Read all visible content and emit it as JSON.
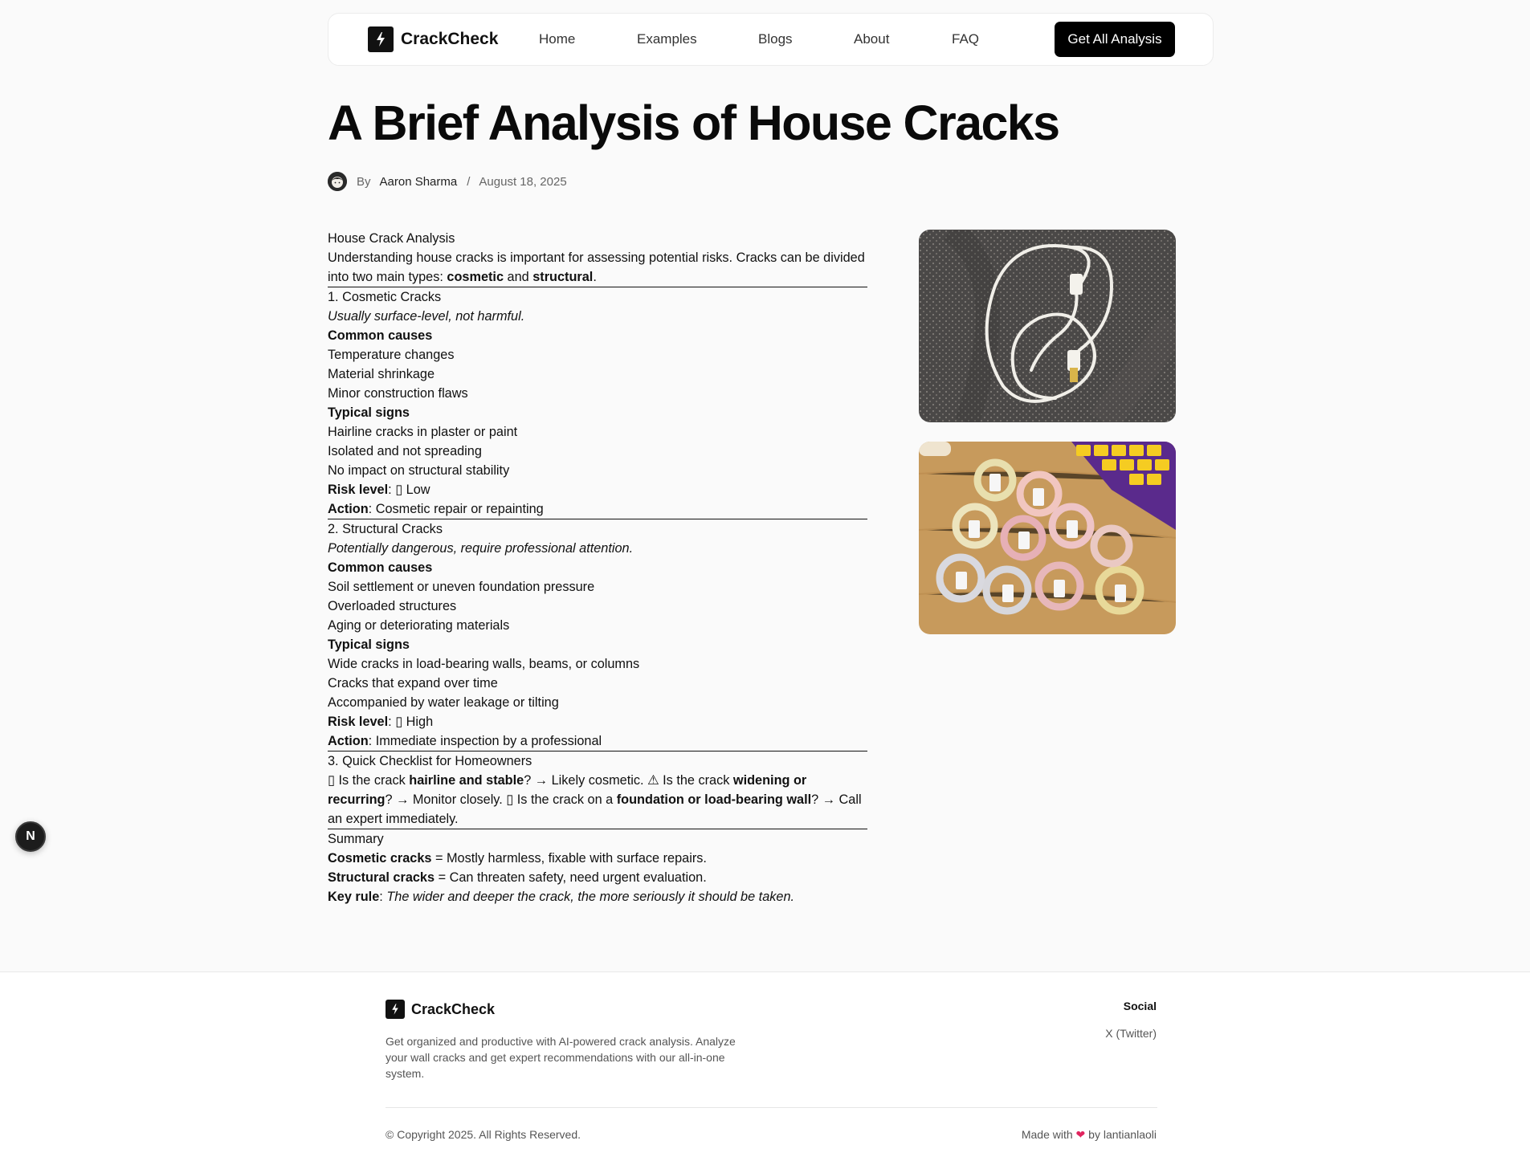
{
  "header": {
    "brand": "CrackCheck",
    "nav": [
      "Home",
      "Examples",
      "Blogs",
      "About",
      "FAQ"
    ],
    "cta": "Get All Analysis"
  },
  "post": {
    "title": "A Brief Analysis of House Cracks",
    "by": "By",
    "author": "Aaron Sharma",
    "separator": "/",
    "date": "August 18, 2025"
  },
  "article": {
    "heading": "House Crack Analysis",
    "intro_1": "Understanding house cracks is important for assessing potential risks. Cracks can be divided into two main types: ",
    "intro_b1": "cosmetic",
    "intro_2": " and ",
    "intro_b2": "structural",
    "intro_3": ".",
    "s1": {
      "title": "1. Cosmetic Cracks",
      "subtitle": "Usually surface-level, not harmful.",
      "causes_label": "Common causes",
      "causes": [
        "Temperature changes",
        "Material shrinkage",
        "Minor construction flaws"
      ],
      "signs_label": "Typical signs",
      "signs": [
        "Hairline cracks in plaster or paint",
        "Isolated and not spreading",
        "No impact on structural stability"
      ],
      "risk_label": "Risk level",
      "risk_value": ": ▯ Low",
      "action_label": "Action",
      "action_value": ": Cosmetic repair or repainting"
    },
    "s2": {
      "title": "2. Structural Cracks",
      "subtitle": "Potentially dangerous, require professional attention.",
      "causes_label": "Common causes",
      "causes": [
        "Soil settlement or uneven foundation pressure",
        "Overloaded structures",
        "Aging or deteriorating materials"
      ],
      "signs_label": "Typical signs",
      "signs": [
        "Wide cracks in load-bearing walls, beams, or columns",
        "Cracks that expand over time",
        "Accompanied by water leakage or tilting"
      ],
      "risk_label": "Risk level",
      "risk_value": ": ▯ High",
      "action_label": "Action",
      "action_value": ": Immediate inspection by a professional"
    },
    "s3": {
      "title": "3. Quick Checklist for Homeowners",
      "c1": "▯ Is the crack ",
      "c1b": "hairline and stable",
      "c2": "? → Likely cosmetic. ⚠ Is the crack ",
      "c2b": "widening or recurring",
      "c3": "? → Monitor closely. ▯ Is the crack on a ",
      "c3b": "foundation or load-bearing wall",
      "c4": "? → Call an expert immediately."
    },
    "summary": {
      "title": "Summary",
      "l1b": "Cosmetic cracks",
      "l1": " = Mostly harmless, fixable with surface repairs.",
      "l2b": "Structural cracks",
      "l2": " = Can threaten safety, need urgent evaluation.",
      "l3b": "Key rule",
      "l3": ": ",
      "l3i": "The wider and deeper the crack, the more seriously it should be taken."
    }
  },
  "badge": "N",
  "footer": {
    "brand": "CrackCheck",
    "description": "Get organized and productive with AI-powered crack analysis. Analyze your wall cracks and get expert recommendations with our all-in-one system.",
    "social_title": "Social",
    "social_link": "X (Twitter)",
    "copyright": "© Copyright 2025. All Rights Reserved.",
    "made_1": "Made with ",
    "heart": "❤",
    "made_2": " by lantianlaoli"
  }
}
